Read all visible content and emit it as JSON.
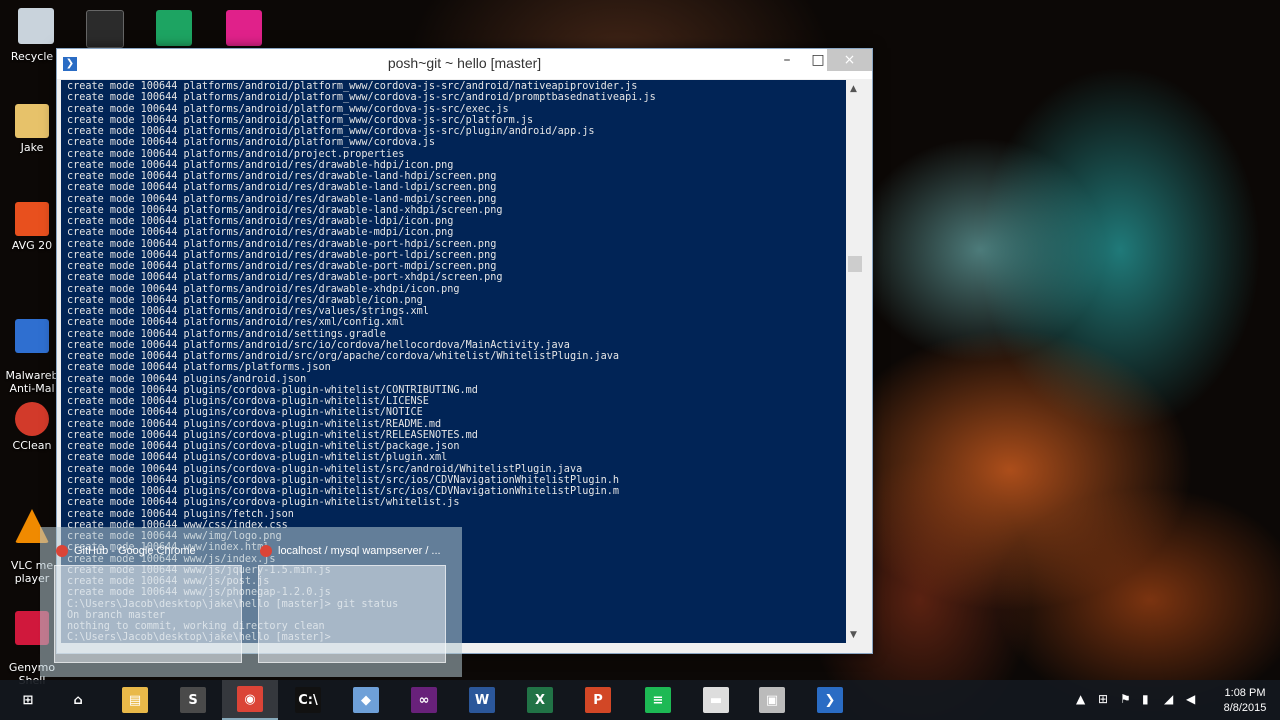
{
  "desktop": {
    "icons": [
      {
        "label": "Recycle",
        "color": "#c9d3dc"
      },
      {
        "label": "Jake",
        "color": "#e7c26a"
      },
      {
        "label": "AVG 20",
        "color": "#e8501e"
      },
      {
        "label": "Malwareb\nAnti-Mal",
        "color": "#2f6fd0"
      },
      {
        "label": "CClean",
        "color": "#d23a2a"
      },
      {
        "label": "VLC me\nplayer",
        "color": "#f08a00"
      },
      {
        "label": "Genymo\nShell",
        "color": "#d0183c"
      }
    ],
    "top_icons": [
      {
        "name": "terminal",
        "color": "#2b2b2b"
      },
      {
        "name": "sheets",
        "color": "#1da462"
      },
      {
        "name": "app",
        "color": "#e0218a"
      }
    ]
  },
  "window": {
    "title": "posh~git ~ hello [master]",
    "icon": "powershell-icon",
    "buttons": {
      "minimize": "–",
      "maximize": "□",
      "close": "×"
    },
    "lines": [
      "create mode 100644 platforms/android/platform_www/cordova-js-src/android/nativeapiprovider.js",
      "create mode 100644 platforms/android/platform_www/cordova-js-src/android/promptbasednativeapi.js",
      "create mode 100644 platforms/android/platform_www/cordova-js-src/exec.js",
      "create mode 100644 platforms/android/platform_www/cordova-js-src/platform.js",
      "create mode 100644 platforms/android/platform_www/cordova-js-src/plugin/android/app.js",
      "create mode 100644 platforms/android/platform_www/cordova.js",
      "create mode 100644 platforms/android/project.properties",
      "create mode 100644 platforms/android/res/drawable-hdpi/icon.png",
      "create mode 100644 platforms/android/res/drawable-land-hdpi/screen.png",
      "create mode 100644 platforms/android/res/drawable-land-ldpi/screen.png",
      "create mode 100644 platforms/android/res/drawable-land-mdpi/screen.png",
      "create mode 100644 platforms/android/res/drawable-land-xhdpi/screen.png",
      "create mode 100644 platforms/android/res/drawable-ldpi/icon.png",
      "create mode 100644 platforms/android/res/drawable-mdpi/icon.png",
      "create mode 100644 platforms/android/res/drawable-port-hdpi/screen.png",
      "create mode 100644 platforms/android/res/drawable-port-ldpi/screen.png",
      "create mode 100644 platforms/android/res/drawable-port-mdpi/screen.png",
      "create mode 100644 platforms/android/res/drawable-port-xhdpi/screen.png",
      "create mode 100644 platforms/android/res/drawable-xhdpi/icon.png",
      "create mode 100644 platforms/android/res/drawable/icon.png",
      "create mode 100644 platforms/android/res/values/strings.xml",
      "create mode 100644 platforms/android/res/xml/config.xml",
      "create mode 100644 platforms/android/settings.gradle",
      "create mode 100644 platforms/android/src/io/cordova/hellocordova/MainActivity.java",
      "create mode 100644 platforms/android/src/org/apache/cordova/whitelist/WhitelistPlugin.java",
      "create mode 100644 platforms/platforms.json",
      "create mode 100644 plugins/android.json",
      "create mode 100644 plugins/cordova-plugin-whitelist/CONTRIBUTING.md",
      "create mode 100644 plugins/cordova-plugin-whitelist/LICENSE",
      "create mode 100644 plugins/cordova-plugin-whitelist/NOTICE",
      "create mode 100644 plugins/cordova-plugin-whitelist/README.md",
      "create mode 100644 plugins/cordova-plugin-whitelist/RELEASENOTES.md",
      "create mode 100644 plugins/cordova-plugin-whitelist/package.json",
      "create mode 100644 plugins/cordova-plugin-whitelist/plugin.xml",
      "create mode 100644 plugins/cordova-plugin-whitelist/src/android/WhitelistPlugin.java",
      "create mode 100644 plugins/cordova-plugin-whitelist/src/ios/CDVNavigationWhitelistPlugin.h",
      "create mode 100644 plugins/cordova-plugin-whitelist/src/ios/CDVNavigationWhitelistPlugin.m",
      "create mode 100644 plugins/cordova-plugin-whitelist/whitelist.js",
      "create mode 100644 plugins/fetch.json",
      "create mode 100644 www/css/index.css",
      "create mode 100644 www/img/logo.png",
      "create mode 100644 www/index.html",
      "create mode 100644 www/js/index.js",
      "create mode 100644 www/js/jquery-1.5.min.js",
      "create mode 100644 www/js/post.js",
      "create mode 100644 www/js/phonegap-1.2.0.js",
      "C:\\Users\\Jacob\\desktop\\jake\\hello [master]> git status",
      "On branch master",
      "nothing to commit, working directory clean",
      "C:\\Users\\Jacob\\desktop\\jake\\hello [master]>"
    ]
  },
  "previews": [
    {
      "label": "GitHub - Google Chrome",
      "icon": "chrome-icon"
    },
    {
      "label": "localhost / mysql wampserver / ...",
      "icon": "chrome-icon"
    }
  ],
  "taskbar": {
    "items": [
      {
        "name": "start",
        "glyph": "⊞",
        "color": "transparent"
      },
      {
        "name": "home",
        "glyph": "⌂",
        "color": "transparent"
      },
      {
        "name": "file-explorer",
        "glyph": "▤",
        "color": "#e9b949"
      },
      {
        "name": "sublime",
        "glyph": "S",
        "color": "#4a4a4a"
      },
      {
        "name": "chrome",
        "glyph": "◉",
        "color": "#db4437"
      },
      {
        "name": "cmd",
        "glyph": "C:\\",
        "color": "#111111"
      },
      {
        "name": "virtualbox",
        "glyph": "◆",
        "color": "#6ea0d8"
      },
      {
        "name": "visual-studio",
        "glyph": "∞",
        "color": "#68217a"
      },
      {
        "name": "word",
        "glyph": "W",
        "color": "#2b579a"
      },
      {
        "name": "excel",
        "glyph": "X",
        "color": "#217346"
      },
      {
        "name": "powerpoint",
        "glyph": "P",
        "color": "#d24726"
      },
      {
        "name": "spotify",
        "glyph": "≡",
        "color": "#1db954"
      },
      {
        "name": "app-white",
        "glyph": "▬",
        "color": "#dddddd"
      },
      {
        "name": "app-grey",
        "glyph": "▣",
        "color": "#bbbbbb"
      },
      {
        "name": "powershell",
        "glyph": "❯",
        "color": "#2a6cc4"
      }
    ],
    "clock": {
      "time": "1:08 PM",
      "date": "8/8/2015"
    }
  }
}
